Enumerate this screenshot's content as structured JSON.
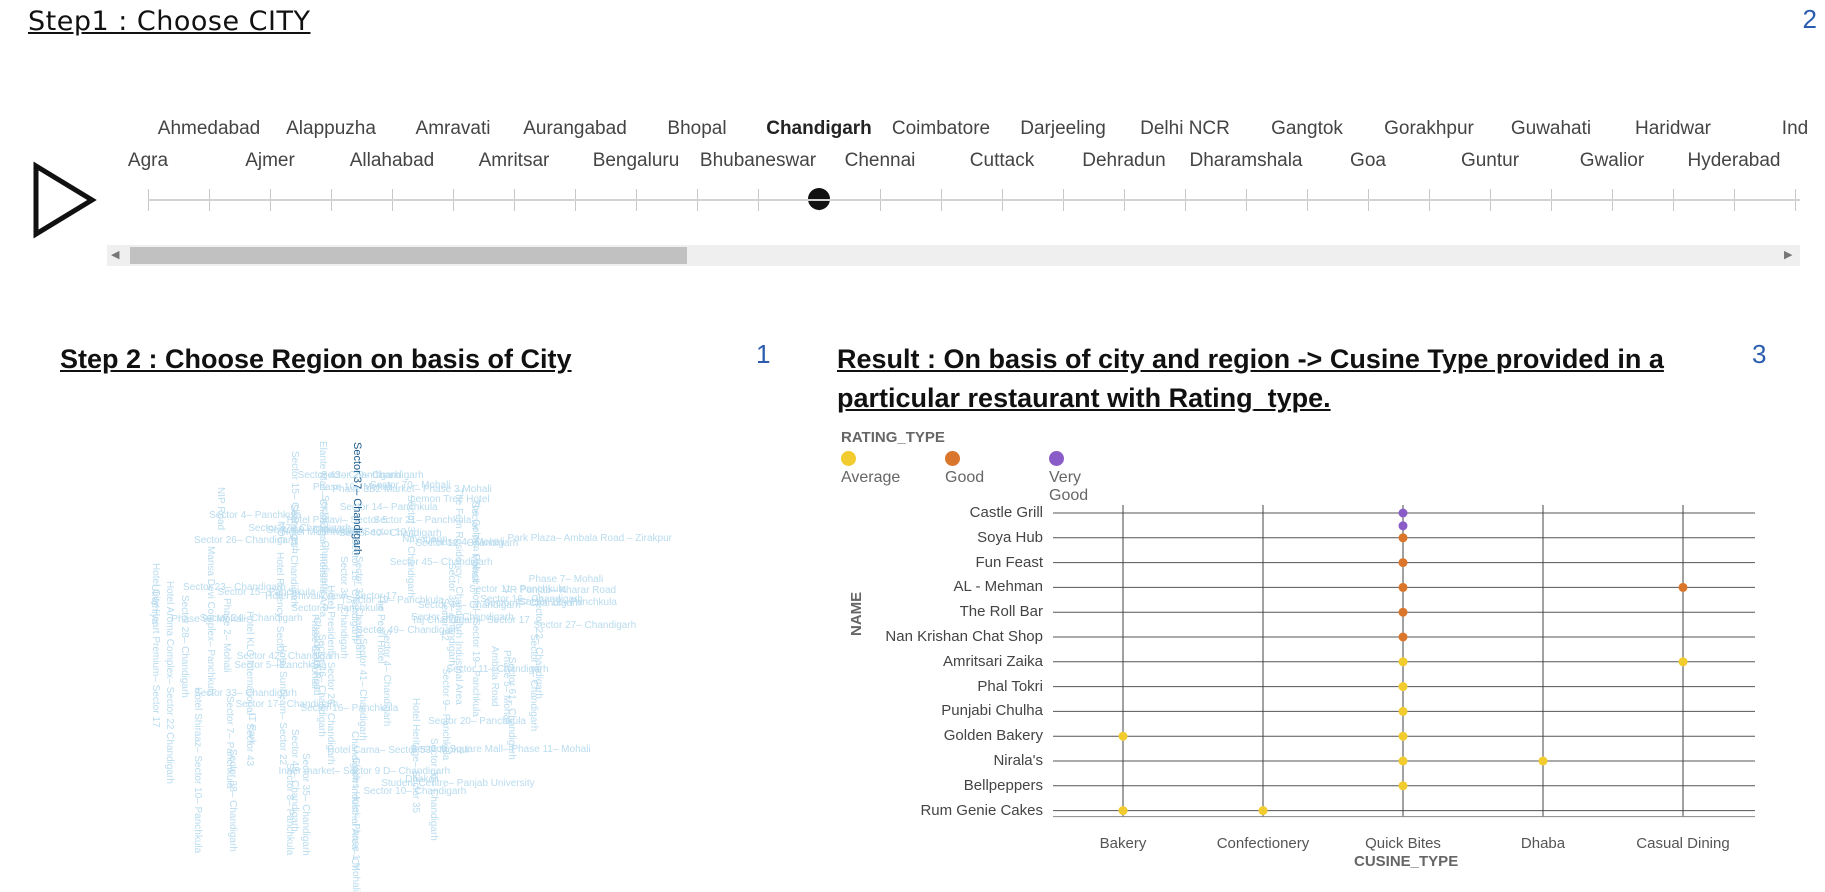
{
  "step1": {
    "title": "Step1  :   Choose CITY",
    "sheet_number": "2",
    "cities_top": [
      "Ahmedabad",
      "Alappuzha",
      "Amravati",
      "Aurangabad",
      "Bhopal",
      "Chandigarh",
      "Coimbatore",
      "Darjeeling",
      "Delhi NCR",
      "Gangtok",
      "Gorakhpur",
      "Guwahati",
      "Haridwar",
      "Ind"
    ],
    "cities_bottom": [
      "Agra",
      "Ajmer",
      "Allahabad",
      "Amritsar",
      "Bengaluru",
      "Bhubaneswar",
      "Chennai",
      "Cuttack",
      "Dehradun",
      "Dharamshala",
      "Goa",
      "Guntur",
      "Gwalior",
      "Hyderabad"
    ],
    "selected_city": "Chandigarh",
    "play_icon": "play-icon",
    "scroll_left_icon": "scroll-left-icon",
    "scroll_right_icon": "scroll-right-icon"
  },
  "step2": {
    "title": "Step 2 : Choose Region on basis of City",
    "sheet_number": "1",
    "highlight_region": "Sector 37– Chandigarh",
    "regions": [
      "Sector 70– Mohali",
      "Chandigarh Road",
      "Ambala Road",
      "IT Park",
      "Phase 9– Mohali",
      "Sector 34– Chandigarh",
      "Sector 14– Panchkula",
      "Sector 28– Chandigarh",
      "Sector 15– Panchkula",
      "Sector 12– Chandigarh",
      "Sector 22– Chandigarh",
      "Sector 32– Chandigarh",
      "Sector 30– Chandigarh",
      "Sector 38– Chandigarh",
      "Sector 42– Chandigarh",
      "Sector 9– Panchkula",
      "Phase 2– Mohali",
      "Utrathiya",
      "Dhakoli",
      "Phase 6– Mohali",
      "Sector 7– Chandigarh",
      "Sector 47– Chandigarh",
      "Sector 26– Chandigarh",
      "Sector 11– Chandigarh",
      "Hotel Pallavi– Sector 5",
      "Hotel Heritage– Sector 35",
      "Hotel Sunbeam– Sector 22",
      "Hotel Cama– Sector 53– Mohali",
      "Phase 3B2 Market– Phase 3 Mohali",
      "Park Plaza– Ambala Road – Zirakpur",
      "Hotel Shiraaz– Sector 10– Panchkula",
      "Bestech Square Mall– Phase 11– Mohali",
      "The Golden Palace Hotel– Sector 19– Panchkula",
      "Chandigarh Industrial Area– Ch",
      "Sector 24– Chandigarh",
      "Hotel KLG International– Sector 43",
      "MDC",
      "The Fern Residency– Chandigarh Industrial Area",
      "Hotel Aroma Complex– Sector 22 Chandigarh",
      "Hotel President– Sector 26– Chandigarh",
      "Sector 82",
      "Inner market– Sector 9 D– Chandigarh",
      "Nayagaon",
      "Mansa Devi Complex– Panchkula",
      "The Pearl Hotel",
      "Glades Hotel– Phase 1 Mohali",
      "Phase 10– Mohali",
      "Taj Chandigarh– Sector 17",
      "Sector 44– Chandigarh",
      "VR Punjab– Kharar Road",
      "Sector 20– Panchkula",
      "Sector 10– Chandigarh",
      "Sector 16– Chandigarh",
      "Sector 8– Chandigarh",
      "Sector 16– Panchkula",
      "Sector 19– Panchkula",
      "Sector 9– Panchkula",
      "Lemon Tree Hotel",
      "Sector 4– Panchkula",
      "Sector 27– Chandigarh",
      "Sector 21– Chandigarh",
      "Sector 17– Chandigarh",
      "Phase 5– Mohali",
      "Sector 71– Mohali",
      "Sector 35– Chandigarh",
      "Sector 40– Chandigarh",
      "Sector 36– Chandigarh",
      "Sector 46– Chandigarh",
      "Sector 23– Chandigarh",
      "Sector 15– Chandigarh",
      "Sector 31– Chandigarh",
      "Sector 18– Chandigarh",
      "Sector 7– Panchkula",
      "Sector 5– Panchkula",
      "Phase 7– Mohali",
      "Sector 11– Panchkula",
      "NIP Road",
      "Student Centre– Panjab University",
      "Hotel Regency– Sector 22",
      "Sector 61– Chandigarh",
      "Phase 4– Mohali",
      "Sector 33– Chandigarh",
      "Sector 45– Chandigarh",
      "Sector 41– Chandigarh",
      "Sector 48– Chandigarh",
      "Sector 49– Chandigarh",
      "Sector 43– Chandigarh",
      "Sector 8– Panchkula",
      "Sector 12– Panchkula",
      "Sector 29– Chandigarh",
      "Hotel Mountview– Sector 10",
      "Hotel City Heart Premium– Sector 17",
      "Sector 4– Chandigarh",
      "Sector 9– Chandigarh",
      "Sector 6– Chandigarh",
      "Sector 21– Panchkula",
      "Sector 39– Chandigarh",
      "Elante Mall– Chandigarh Industrial Area",
      "Hotel Shivalikview– Sector 17"
    ]
  },
  "result": {
    "title_line1": "Result : On basis of city and region -> Cusine Type provided in a",
    "title_line2": "particular restaurant with Rating_type.",
    "sheet_number": "3"
  },
  "chart_data": {
    "type": "scatter",
    "title": "",
    "xlabel": "CUSINE_TYPE",
    "ylabel": "NAME",
    "legend_title": "RATING_TYPE",
    "legend_placement": "top-left",
    "categories_x": [
      "Bakery",
      "Confectionery",
      "Quick Bites",
      "Dhaba",
      "Casual Dining"
    ],
    "categories_y": [
      "Castle Grill",
      "Soya Hub",
      "Fun Feast",
      "AL - Mehman",
      "The Roll Bar",
      "Nan Krishan Chat Shop",
      "Amritsari Zaika",
      "Phal Tokri",
      "Punjabi Chulha",
      "Golden Bakery",
      "Nirala's",
      "Bellpeppers",
      "Rum Genie Cakes"
    ],
    "grid": true,
    "series": [
      {
        "name": "Average",
        "color": "#f2cb2f",
        "points": [
          {
            "x": "Quick Bites",
            "y": "Amritsari Zaika"
          },
          {
            "x": "Casual Dining",
            "y": "Amritsari Zaika"
          },
          {
            "x": "Quick Bites",
            "y": "Phal Tokri"
          },
          {
            "x": "Quick Bites",
            "y": "Punjabi Chulha"
          },
          {
            "x": "Bakery",
            "y": "Golden Bakery"
          },
          {
            "x": "Quick Bites",
            "y": "Golden Bakery"
          },
          {
            "x": "Dhaba",
            "y": "Nirala's"
          },
          {
            "x": "Quick Bites",
            "y": "Nirala's"
          },
          {
            "x": "Quick Bites",
            "y": "Bellpeppers"
          },
          {
            "x": "Bakery",
            "y": "Rum Genie Cakes"
          },
          {
            "x": "Confectionery",
            "y": "Rum Genie Cakes"
          }
        ]
      },
      {
        "name": "Good",
        "color": "#d9762b",
        "points": [
          {
            "x": "Quick Bites",
            "y": "Fun Feast"
          },
          {
            "x": "Quick Bites",
            "y": "AL - Mehman"
          },
          {
            "x": "Casual Dining",
            "y": "AL - Mehman"
          },
          {
            "x": "Quick Bites",
            "y": "The Roll Bar"
          },
          {
            "x": "Quick Bites",
            "y": "Nan Krishan Chat Shop"
          },
          {
            "x": "Quick Bites",
            "y": "Soya Hub"
          }
        ]
      },
      {
        "name": "Very Good",
        "color": "#8a5cc7",
        "points": [
          {
            "x": "Quick Bites",
            "y": "Castle Grill"
          },
          {
            "x": "Quick Bites",
            "y": "Soya Hub"
          }
        ]
      }
    ]
  }
}
